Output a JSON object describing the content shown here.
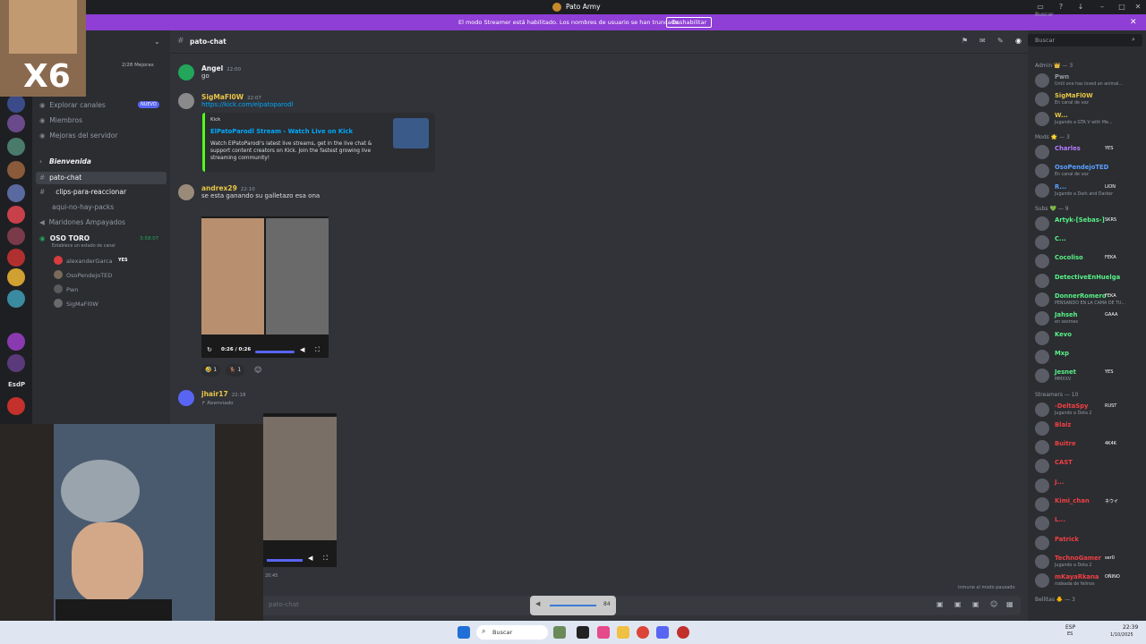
{
  "window": {
    "title": "Pato Army"
  },
  "banner": {
    "message": "El modo Streamer está habilitado. Los nombres de usuario se han truncado.",
    "button": "Deshabilitar"
  },
  "overlay": {
    "multiplier": "X6"
  },
  "server_list": {
    "label": "EsdP"
  },
  "sidebar": {
    "boost_count": "2/28 Mejoras",
    "items": [
      {
        "label": "Explorar canales",
        "badge": "NUEVO"
      },
      {
        "label": "Miembros"
      },
      {
        "label": "Mejoras del servidor"
      }
    ],
    "category": "Bienvenida",
    "channels": [
      "pato-chat",
      "clips-para-reaccionar",
      "aqui-no-hay-packs",
      "Maridones Ampayados"
    ],
    "voice_channel": {
      "name": "OSO TORO",
      "timer": "3:58:07",
      "status": "Establece un estado de canal",
      "users": [
        "alexanderGarca",
        "OsoPendejoTED",
        "Pwn",
        "SigMaFl0W"
      ],
      "badge": "YES"
    }
  },
  "chat": {
    "channel_name": "pato-chat",
    "search_placeholder": "Buscar",
    "messages": [
      {
        "user": "Angel",
        "time": "22:00",
        "text": "go",
        "color": "#dbdee1"
      },
      {
        "user": "SigMaFl0W",
        "time": "22:07",
        "link": "https://kick.com/elpatoparodl",
        "color": "#e8c547"
      },
      {
        "user": "andrex29",
        "time": "22:10",
        "text": "se esta ganando su galletazo esa ona",
        "color": "#e8c547"
      },
      {
        "user": "jhair17",
        "time": "22:18",
        "forwarded": "Reenviado",
        "color": "#e8c547"
      }
    ],
    "embed": {
      "provider": "Kick",
      "title": "ElPatoParodl Stream - Watch Live on Kick",
      "description": "Watch ElPatoParodl's latest live streams, get in the live chat & support content creators on Kick. Join the fastest growing live streaming community!"
    },
    "video": {
      "time": "0:26 / 0:26"
    },
    "reactions": [
      {
        "emoji": "🤣",
        "count": "1"
      },
      {
        "emoji": "🦌",
        "count": "1"
      }
    ],
    "last_time": "20:45",
    "input_placeholder": "pato-chat",
    "status_line": "inmune al modo pausado",
    "volume": "84"
  },
  "members": {
    "groups": [
      {
        "name": "Admin 👑 — 3",
        "list": [
          {
            "name": "Pwn",
            "status": "Until one has loved an animal...",
            "color": "#949ba4"
          },
          {
            "name": "SigMaFl0W",
            "status": "En canal de voz",
            "color": "#e8c547"
          },
          {
            "name": "W...",
            "status": "Jugando a GTA V with Me...",
            "color": "#e8c547"
          }
        ]
      },
      {
        "name": "Mods 🌟 — 3",
        "list": [
          {
            "name": "Charles",
            "status": "",
            "tag": "YES",
            "color": "#b57bff"
          },
          {
            "name": "OsoPendejoTED",
            "status": "En canal de voz",
            "color": "#5aa0ff"
          },
          {
            "name": "R...",
            "status": "Jugando a Dark and Darker",
            "tag": "LION",
            "color": "#5aa0ff"
          }
        ]
      },
      {
        "name": "Subs 💚 — 9",
        "list": [
          {
            "name": "Artyk-[Sebas-]",
            "tag": "SKRS",
            "status": "",
            "color": "#57f287"
          },
          {
            "name": "C...",
            "status": "",
            "color": "#57f287"
          },
          {
            "name": "Cocoliso",
            "tag": "FEKA",
            "status": "",
            "color": "#57f287"
          },
          {
            "name": "DetectiveEnHuelga",
            "status": "",
            "color": "#57f287"
          },
          {
            "name": "DonnerRomero",
            "tag": "FEKA",
            "status": "PENSANDO EN LA CAMA DE TU...",
            "color": "#57f287"
          },
          {
            "name": "Jahseh",
            "tag": "GAAA",
            "status": "en sexmex",
            "color": "#57f287"
          },
          {
            "name": "Kevo",
            "status": "",
            "color": "#57f287"
          },
          {
            "name": "Mxp",
            "status": "",
            "color": "#57f287"
          },
          {
            "name": "Jesnet",
            "tag": "YES",
            "status": "MMXXV",
            "color": "#57f287"
          }
        ]
      },
      {
        "name": "Streamers — 10",
        "list": [
          {
            "name": "-DeltaSpy",
            "tag": "RUST",
            "status": "Jugando a Dota 2",
            "color": "#f23f43"
          },
          {
            "name": "Blaiz",
            "status": "",
            "color": "#f23f43"
          },
          {
            "name": "Buitre",
            "tag": "4K4K",
            "status": "",
            "color": "#f23f43"
          },
          {
            "name": "CAST",
            "status": "",
            "color": "#f23f43"
          },
          {
            "name": "J...",
            "status": "",
            "color": "#f23f43"
          },
          {
            "name": "Kimi_chan",
            "tag": "ネウイ",
            "status": "",
            "color": "#f23f43"
          },
          {
            "name": "L...",
            "status": "",
            "color": "#f23f43"
          },
          {
            "name": "Patrick",
            "status": "",
            "color": "#f23f43"
          },
          {
            "name": "TechnoGamer",
            "tag": "ser0",
            "status": "Jugando a Dota 2",
            "color": "#f23f43"
          },
          {
            "name": "mKayaRkana",
            "tag": "OÑINO",
            "status": "rodeada de felinos",
            "color": "#f23f43"
          }
        ]
      }
    ],
    "footer": "Bellitas 🐥 — 3"
  },
  "taskbar": {
    "search": "Buscar",
    "time": "22:39",
    "date": "1/10/2025",
    "lang": "ESP",
    "lang2": "ES"
  }
}
